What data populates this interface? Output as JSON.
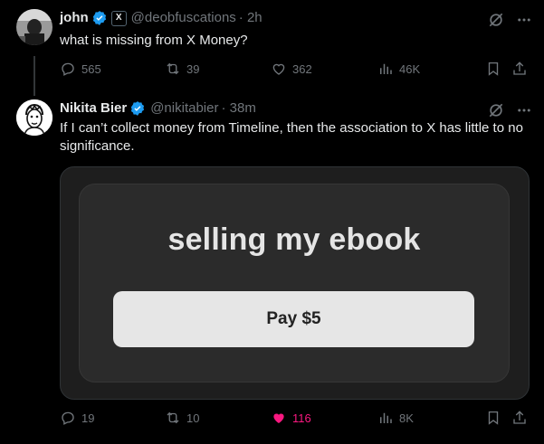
{
  "colors": {
    "like_pink": "#f91880",
    "verified_blue": "#1d9bf0",
    "muted_gray": "#71767b"
  },
  "post1": {
    "name": "john",
    "affiliate_badge": "X",
    "handle": "@deobfuscations",
    "time": "· 2h",
    "text": "what is missing from X Money?",
    "stats": {
      "replies": "565",
      "reposts": "39",
      "likes": "362",
      "views": "46K"
    }
  },
  "post2": {
    "name": "Nikita Bier",
    "handle": "@nikitabier",
    "time": "· 38m",
    "text": "If I can’t collect money from Timeline, then the association to X has little to no significance.",
    "card": {
      "title": "selling my ebook",
      "button_label": "Pay $5"
    },
    "stats": {
      "replies": "19",
      "reposts": "10",
      "likes": "116",
      "views": "8K"
    }
  }
}
